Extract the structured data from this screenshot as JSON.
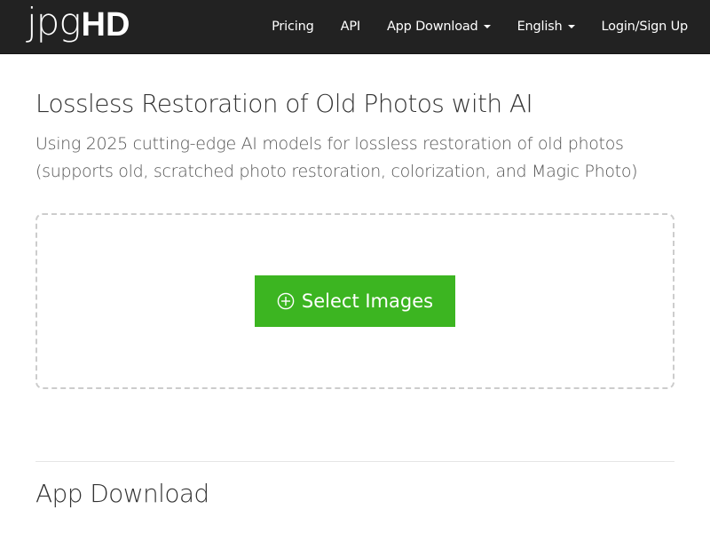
{
  "logo": {
    "light_part": "jpg",
    "bold_part": "HD"
  },
  "nav": {
    "pricing": "Pricing",
    "api": "API",
    "app_download": "App Download",
    "language": "English",
    "login": "Login/Sign Up"
  },
  "hero": {
    "title": "Lossless Restoration of Old Photos with AI",
    "subtitle": "Using 2025 cutting-edge AI models for lossless restoration of old photos (supports old, scratched photo restoration, colorization, and Magic Photo)"
  },
  "upload": {
    "button_label": "Select Images",
    "button_icon": "plus-circle-icon"
  },
  "sections": {
    "app_download_title": "App Download"
  },
  "colors": {
    "navbar_bg": "#222222",
    "primary_green": "#3cb521",
    "dashed_border": "#cccccc"
  }
}
